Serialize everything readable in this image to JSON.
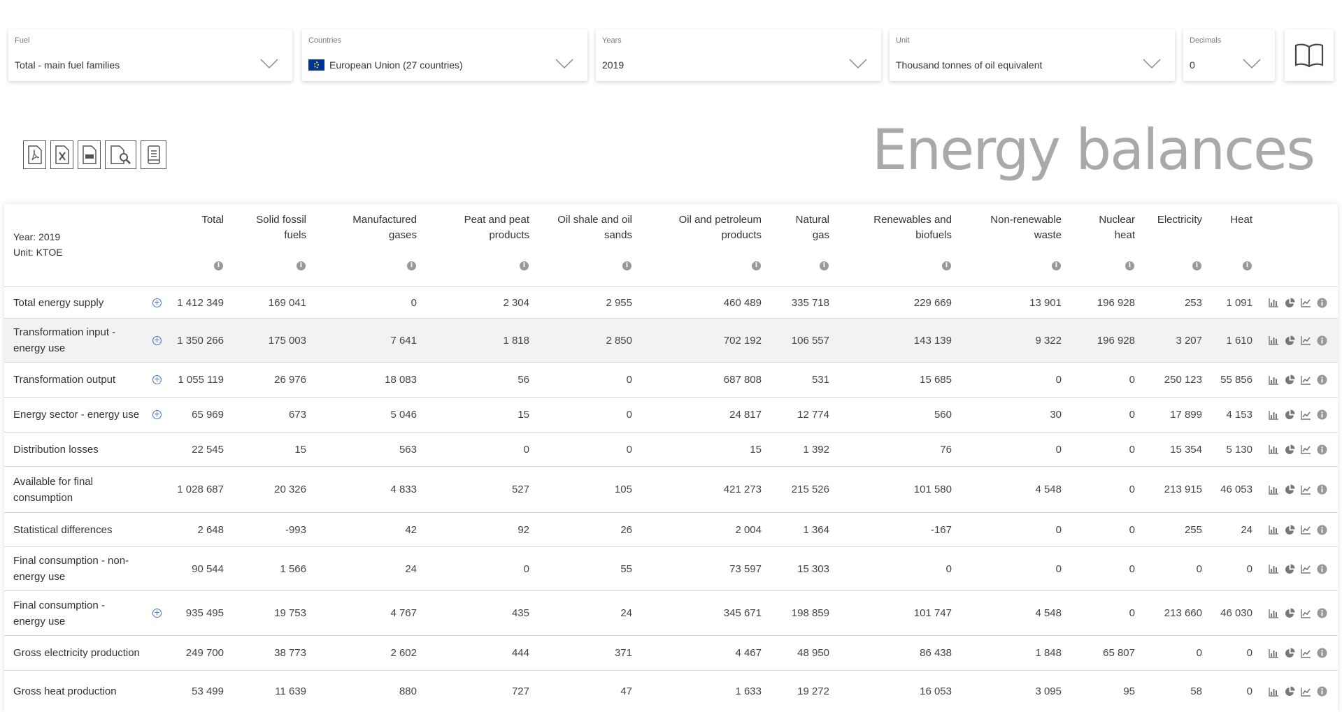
{
  "filters": {
    "fuel": {
      "label": "Fuel",
      "value": "Total - main fuel families"
    },
    "countries": {
      "label": "Countries",
      "value": "European Union (27 countries)"
    },
    "years": {
      "label": "Years",
      "value": "2019"
    },
    "unit": {
      "label": "Unit",
      "value": "Thousand tonnes of oil equivalent"
    },
    "decimals": {
      "label": "Decimals",
      "value": "0"
    }
  },
  "toolbar": {
    "icons": [
      "pdf-icon",
      "excel-icon",
      "csv-icon",
      "document-search-icon",
      "book-icon"
    ]
  },
  "page_title": "Energy balances",
  "table": {
    "year_label": "Year: 2019",
    "unit_label": "Unit: KTOE",
    "columns": [
      [
        "Total"
      ],
      [
        "Solid fossil",
        "fuels"
      ],
      [
        "Manufactured",
        "gases"
      ],
      [
        "Peat and peat",
        "products"
      ],
      [
        "Oil shale and oil",
        "sands"
      ],
      [
        "Oil and petroleum",
        "products"
      ],
      [
        "Natural",
        "gas"
      ],
      [
        "Renewables and",
        "biofuels"
      ],
      [
        "Non-renewable",
        "waste"
      ],
      [
        "Nuclear",
        "heat"
      ],
      [
        "Electricity"
      ],
      [
        "Heat"
      ]
    ],
    "rows": [
      {
        "label": [
          "Total energy supply"
        ],
        "expand": true,
        "values": [
          "1 412 349",
          "169 041",
          "0",
          "2 304",
          "2 955",
          "460 489",
          "335 718",
          "229 669",
          "13 901",
          "196 928",
          "253",
          "1 091"
        ]
      },
      {
        "label": [
          "Transformation input -",
          "energy use"
        ],
        "expand": true,
        "values": [
          "1 350 266",
          "175 003",
          "7 641",
          "1 818",
          "2 850",
          "702 192",
          "106 557",
          "143 139",
          "9 322",
          "196 928",
          "3 207",
          "1 610"
        ]
      },
      {
        "label": [
          "Transformation output"
        ],
        "expand": true,
        "values": [
          "1 055 119",
          "26 976",
          "18 083",
          "56",
          "0",
          "687 808",
          "531",
          "15 685",
          "0",
          "0",
          "250 123",
          "55 856"
        ]
      },
      {
        "label": [
          "Energy sector - energy use"
        ],
        "expand": true,
        "values": [
          "65 969",
          "673",
          "5 046",
          "15",
          "0",
          "24 817",
          "12 774",
          "560",
          "30",
          "0",
          "17 899",
          "4 153"
        ]
      },
      {
        "label": [
          "Distribution losses"
        ],
        "expand": false,
        "values": [
          "22 545",
          "15",
          "563",
          "0",
          "0",
          "15",
          "1 392",
          "76",
          "0",
          "0",
          "15 354",
          "5 130"
        ]
      },
      {
        "label": [
          "Available for final",
          "consumption"
        ],
        "expand": false,
        "values": [
          "1 028 687",
          "20 326",
          "4 833",
          "527",
          "105",
          "421 273",
          "215 526",
          "101 580",
          "4 548",
          "0",
          "213 915",
          "46 053"
        ]
      },
      {
        "label": [
          "Statistical differences"
        ],
        "expand": false,
        "values": [
          "2 648",
          "-993",
          "42",
          "92",
          "26",
          "2 004",
          "1 364",
          "-167",
          "0",
          "0",
          "255",
          "24"
        ]
      },
      {
        "label": [
          "Final consumption - non-",
          "energy use"
        ],
        "expand": false,
        "values": [
          "90 544",
          "1 566",
          "24",
          "0",
          "55",
          "73 597",
          "15 303",
          "0",
          "0",
          "0",
          "0",
          "0"
        ]
      },
      {
        "label": [
          "Final consumption -",
          "energy use"
        ],
        "expand": true,
        "values": [
          "935 495",
          "19 753",
          "4 767",
          "435",
          "24",
          "345 671",
          "198 859",
          "101 747",
          "4 548",
          "0",
          "213 660",
          "46 030"
        ]
      },
      {
        "label": [
          "Gross electricity production"
        ],
        "expand": false,
        "values": [
          "249 700",
          "38 773",
          "2 602",
          "444",
          "371",
          "4 467",
          "48 950",
          "86 438",
          "1 848",
          "65 807",
          "0",
          "0"
        ]
      },
      {
        "label": [
          "Gross heat production"
        ],
        "expand": false,
        "values": [
          "53 499",
          "11 639",
          "880",
          "727",
          "47",
          "1 633",
          "19 272",
          "16 053",
          "3 095",
          "95",
          "58",
          "0"
        ]
      }
    ],
    "row_actions": [
      "bar-chart-icon",
      "pie-chart-icon",
      "line-chart-icon",
      "info-icon"
    ]
  },
  "colors": {
    "accent": "#4a6fd0",
    "title": "#a9a9a9",
    "eu_flag": "#003399"
  }
}
